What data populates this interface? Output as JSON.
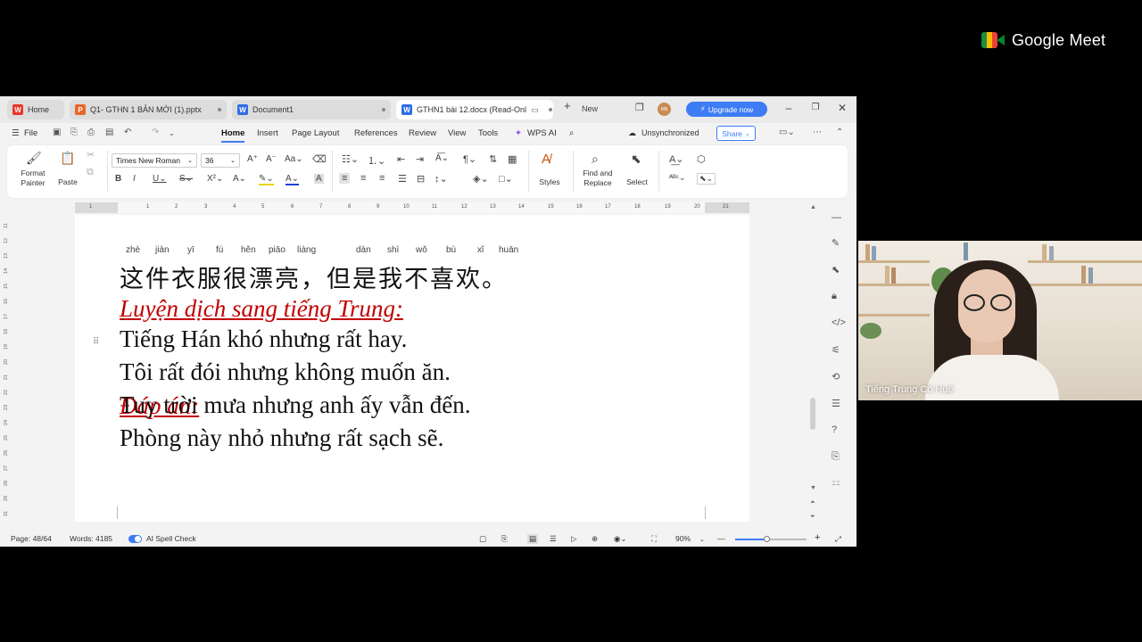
{
  "meet": {
    "brand": "Google Meet",
    "participant_name": "Tiếng Trung Cô Huệ"
  },
  "tabs": [
    {
      "label": "Home",
      "icon_text": "W",
      "icon_color": "#e8362a"
    },
    {
      "label": "Q1- GTHN 1 BẢN MỚI (1).pptx",
      "icon_text": "P",
      "icon_color": "#e8682a"
    },
    {
      "label": "Document1",
      "icon_text": "W",
      "icon_color": "#2f6fe4"
    },
    {
      "label": "GTHN1 bài 12.docx (Read-Onl",
      "icon_text": "W",
      "icon_color": "#2f6fe4"
    }
  ],
  "tabbar": {
    "new_label": "New",
    "upgrade_label": "Upgrade now",
    "avatar_initials": "MN"
  },
  "menu": {
    "file": "File",
    "items": [
      "Home",
      "Insert",
      "Page Layout",
      "References",
      "Review",
      "View",
      "Tools"
    ],
    "wps_ai": "WPS AI",
    "sync_status": "Unsynchronized",
    "share": "Share"
  },
  "ribbon": {
    "format_painter": "Format Painter",
    "paste": "Paste",
    "font_name": "Times New Roman",
    "font_size": "36",
    "styles": "Styles",
    "find_replace": "Find and Replace",
    "select": "Select"
  },
  "ruler": {
    "numbers": [
      "1",
      "1",
      "2",
      "3",
      "4",
      "5",
      "6",
      "7",
      "8",
      "9",
      "10",
      "11",
      "12",
      "13",
      "14",
      "15",
      "16",
      "17",
      "18",
      "19",
      "20",
      "21"
    ]
  },
  "vruler": {
    "numbers": [
      "11",
      "12",
      "13",
      "14",
      "15",
      "16",
      "17",
      "18",
      "19",
      "20",
      "21",
      "22",
      "23",
      "24",
      "25",
      "26",
      "27",
      "28",
      "29",
      "31"
    ]
  },
  "document": {
    "pinyin": [
      "zhè",
      "jiàn",
      "yī",
      "fú",
      "hěn",
      "piāo",
      "liàng",
      "dàn",
      "shì",
      "wǒ",
      "bù",
      "xǐ",
      "huān"
    ],
    "chinese_line": "这件衣服很漂亮，但是我不喜欢。",
    "heading_translate": "Luyện dịch sang tiếng Trung:",
    "sentences": [
      "Tiếng Hán khó nhưng rất hay.",
      "Tôi rất đói nhưng không muốn ăn.",
      "Tuy trời mưa nhưng anh ấy vẫn đến.",
      "Phòng này nhỏ nhưng rất sạch sẽ."
    ],
    "heading_answer": "Đáp án:"
  },
  "status": {
    "page": "Page: 48/64",
    "words": "Words: 4185",
    "spell": "AI Spell Check",
    "zoom": "90%",
    "zoom_fraction": 0.45
  },
  "colors": {
    "accent": "#3d7cf5",
    "heading_red": "#c00000"
  }
}
